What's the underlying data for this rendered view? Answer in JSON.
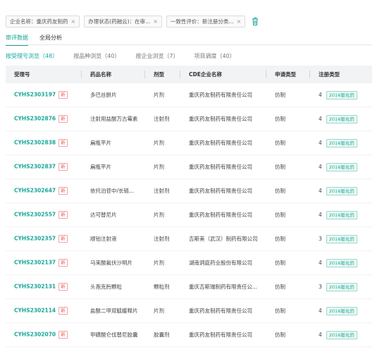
{
  "filters": [
    {
      "text": "企业名称：重庆药友制药"
    },
    {
      "text": "办理状态(药融云)：在审..."
    },
    {
      "text": "一致性评价：新注册分类..."
    }
  ],
  "main_tabs": [
    "审评数据",
    "全局分析"
  ],
  "sub_tabs": [
    "按受理号浏览（48）",
    "按品种浏览（40）",
    "按企业浏览（7）",
    "项目调度（40）"
  ],
  "columns": [
    "受理号",
    "药品名称",
    "剂型",
    "CDE企业名称",
    "申请类型",
    "注册类型"
  ],
  "new_label": "新",
  "rows": [
    {
      "code": "CYHS2303197",
      "name": "多巴丝肼片",
      "form": "片剂",
      "company": "重庆药友制药有限责任公司",
      "apply": "仿制",
      "reg_num": "4",
      "reg_tag": "2016版化药"
    },
    {
      "code": "CYHS2302876",
      "name": "注射用盐酸万古霉素",
      "form": "注射剂",
      "company": "重庆药友制药有限责任公司",
      "apply": "仿制",
      "reg_num": "4",
      "reg_tag": "2016版化药"
    },
    {
      "code": "CYHS2302838",
      "name": "扁瓶平片",
      "form": "片剂",
      "company": "重庆药友制药有限责任公司",
      "apply": "仿制",
      "reg_num": "4",
      "reg_tag": "2016版化药"
    },
    {
      "code": "CYHS2302837",
      "name": "扁瓶平片",
      "form": "片剂",
      "company": "重庆药友制药有限责任公司",
      "apply": "仿制",
      "reg_num": "4",
      "reg_tag": "2016版化药"
    },
    {
      "code": "CYHS2302647",
      "name": "依托泊苷中/长链...",
      "form": "注射剂",
      "company": "重庆药友制药有限责任公司",
      "apply": "仿制",
      "reg_num": "4",
      "reg_tag": "2016版化药"
    },
    {
      "code": "CYHS2302557",
      "name": "达可替尼片",
      "form": "片剂",
      "company": "重庆药友制药有限责任公司",
      "apply": "仿制",
      "reg_num": "4",
      "reg_tag": "2016版化药"
    },
    {
      "code": "CYHS2302357",
      "name": "顺铂注射液",
      "form": "注射剂",
      "company": "吉斯美（武汉）制药有限公司",
      "apply": "仿制",
      "reg_num": "3",
      "reg_tag": "2016版化药"
    },
    {
      "code": "CYHS2302137",
      "name": "马来酸氟伏沙明片",
      "form": "片剂",
      "company": "湖南洞庭药业股份有限公司",
      "apply": "仿制",
      "reg_num": "4",
      "reg_tag": "2016版化药"
    },
    {
      "code": "CYHS2302131",
      "name": "头孢克肟颗粒",
      "form": "颗粒剂",
      "company": "重庆吉斯瑞制药有限责任公...",
      "apply": "仿制",
      "reg_num": "3",
      "reg_tag": "2016版化药"
    },
    {
      "code": "CYHS2302114",
      "name": "盐酸二甲双胍缓释片",
      "form": "片剂",
      "company": "重庆药友制药有限责任公司",
      "apply": "仿制",
      "reg_num": "4",
      "reg_tag": "2016版化药"
    },
    {
      "code": "CYHS2302070",
      "name": "甲磺酸仑伐替尼胶囊",
      "form": "胶囊剂",
      "company": "重庆药友制药有限责任公司",
      "apply": "仿制",
      "reg_num": "4",
      "reg_tag": "2016版化药"
    }
  ],
  "colors": {
    "accent": "#1aa79b",
    "new_tag": "#e25c5c"
  }
}
